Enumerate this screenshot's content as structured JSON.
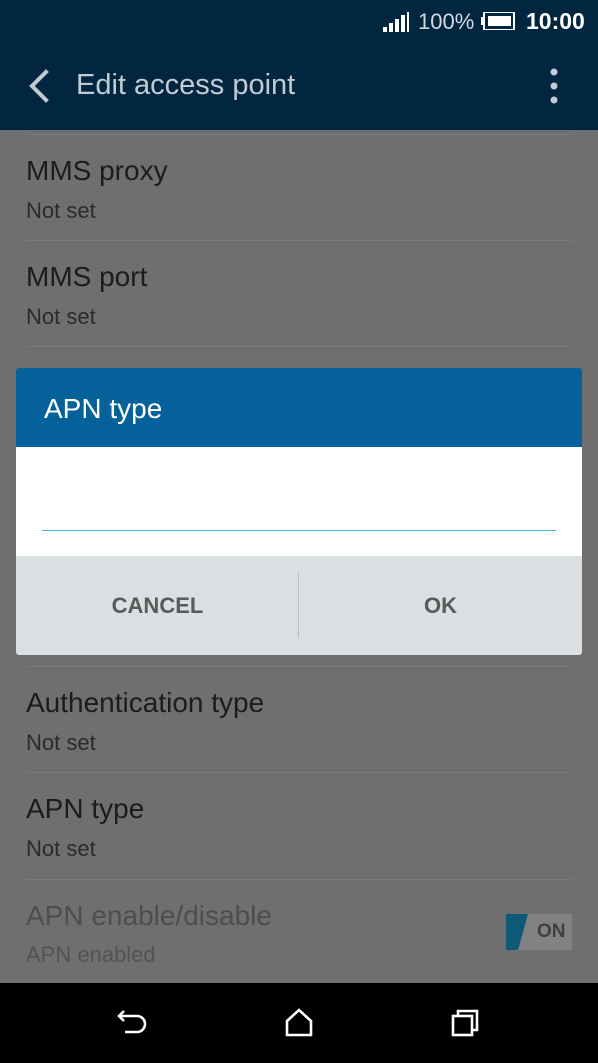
{
  "status_bar": {
    "battery_percent": "100%",
    "time": "10:00",
    "signal_icon": "signal-bars-icon",
    "battery_icon": "battery-icon"
  },
  "app_bar": {
    "title": "Edit access point",
    "back_icon": "chevron-left-icon",
    "menu_icon": "more-vert-icon"
  },
  "settings": [
    {
      "title": "MMS proxy",
      "value": "Not set"
    },
    {
      "title": "MMS port",
      "value": "Not set"
    },
    {
      "title": "Authentication type",
      "value": "Not set"
    },
    {
      "title": "APN type",
      "value": "Not set"
    },
    {
      "title": "APN enable/disable",
      "value": "APN enabled",
      "toggle": "ON"
    }
  ],
  "dialog": {
    "title": "APN type",
    "input_value": "",
    "cancel_label": "CANCEL",
    "ok_label": "OK"
  },
  "nav_bar": {
    "back_icon": "back-arrow-icon",
    "home_icon": "home-icon",
    "recents_icon": "recents-icon"
  },
  "colors": {
    "app_bar": "#022640",
    "dialog_header": "#04619a",
    "input_underline": "#3fb8d0",
    "toggle_accent": "#0f5a78"
  }
}
